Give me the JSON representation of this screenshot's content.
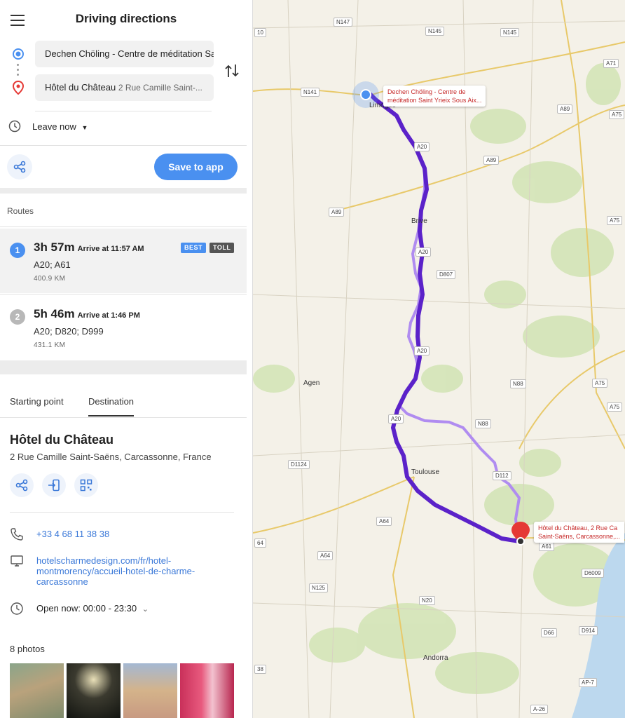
{
  "header": {
    "title": "Driving directions"
  },
  "waypoints": {
    "origin": "Dechen Chöling - Centre de méditation Saint Yrieix Sous Aixe",
    "destination_name": "Hôtel du Château",
    "destination_sub": "2 Rue Camille Saint-..."
  },
  "depart": {
    "label": "Leave now"
  },
  "actions": {
    "save_label": "Save to app"
  },
  "routes": {
    "heading": "Routes",
    "items": [
      {
        "num": "1",
        "duration": "3h 57m",
        "arrive": "Arrive at 11:57 AM",
        "roads": "A20; A61",
        "distance": "400.9 KM",
        "badges": [
          "BEST",
          "TOLL"
        ]
      },
      {
        "num": "2",
        "duration": "5h 46m",
        "arrive": "Arrive at 1:46 PM",
        "roads": "A20; D820; D999",
        "distance": "431.1 KM",
        "badges": []
      }
    ]
  },
  "tabs": {
    "start": "Starting point",
    "destination": "Destination"
  },
  "place": {
    "name": "Hôtel du Château",
    "address": "2 Rue Camille Saint-Saëns, Carcassonne, France",
    "phone": "+33 4 68 11 38 38",
    "website_line1": "hotelscharmedesign.com/fr/hotel-",
    "website_line2": "montmorency/accueil-hotel-de-charme-",
    "website_line3": "carcassonne",
    "hours": "Open now: 00:00 - 23:30",
    "photos_label": "8 photos"
  },
  "map": {
    "origin_callout_line1": "Dechen Chöling - Centre de",
    "origin_callout_line2": "méditation Saint Yrieix Sous Aix...",
    "dest_callout_line1": "Hôtel du Château, 2 Rue Ca",
    "dest_callout_line2": "Saint-Saëns, Carcassonne,...",
    "cities": [
      "Limoges",
      "Brive",
      "Agen",
      "Toulouse",
      "Andorra"
    ],
    "roads": [
      "N147",
      "N145",
      "N145",
      "A71",
      "N141",
      "A89",
      "A75",
      "A20",
      "A89",
      "A89",
      "A75",
      "A20",
      "D807",
      "A20",
      "N88",
      "A75",
      "A75",
      "A20",
      "N88",
      "D1124",
      "D112",
      "A64",
      "A64",
      "A61",
      "D6009",
      "N125",
      "N20",
      "D66",
      "D914",
      "AP-7",
      "A-26",
      "10",
      "64",
      "38"
    ]
  },
  "colors": {
    "primary_route": "#5b22c9",
    "alt_route": "#b08cf0",
    "accent": "#4a90f0",
    "dest_marker": "#e53935"
  }
}
